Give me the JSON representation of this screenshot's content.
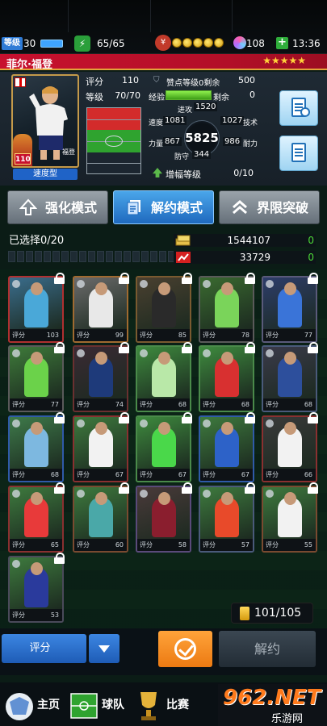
{
  "status": {
    "level_label": "等级",
    "level": "30",
    "energy": "65/65",
    "gems": "108",
    "time": "13:36"
  },
  "player": {
    "name": "菲尔·福登",
    "stars": "★★★★★",
    "card_rating": "110",
    "card_name": "福登",
    "type": "速度型",
    "rating_label": "评分",
    "rating": "110",
    "level_label": "等级",
    "level": "70/70",
    "likes_label": "赞点等级0剩余",
    "likes_remaining": "500",
    "exp_label": "经验",
    "exp_remaining_label": "剩余",
    "exp_remaining": "0",
    "exp_fill": 1.0,
    "attack_label": "进攻",
    "attack": "1520",
    "speed_label": "速度",
    "speed": "1081",
    "technique_value": "1027",
    "technique_label": "技术",
    "overall": "5825",
    "power_label": "力量",
    "power": "867",
    "stamina_value": "986",
    "stamina_label": "耐力",
    "defense_label": "防守",
    "defense": "344",
    "boost_label": "增幅等级",
    "boost": "0/10"
  },
  "tabs": [
    {
      "label": "强化模式"
    },
    {
      "label": "解约模式"
    },
    {
      "label": "界限突破"
    }
  ],
  "selection": {
    "label": "已选择0/20",
    "money": "1544107",
    "money_extra": "0",
    "points": "33729",
    "points_extra": "0"
  },
  "cards": [
    {
      "score_label": "评分",
      "score": "103",
      "bg": "#3a6d8c",
      "shirt": "#4aa8d8",
      "frame": "#b03030"
    },
    {
      "score_label": "评分",
      "score": "99",
      "bg": "#6b6b6b",
      "shirt": "#e8e8e8",
      "frame": "#a06a30"
    },
    {
      "score_label": "评分",
      "score": "85",
      "bg": "#4a4030",
      "shirt": "#2a2a2a",
      "frame": "#7a5a30"
    },
    {
      "score_label": "评分",
      "score": "78",
      "bg": "#3a6a30",
      "shirt": "#7ad45a",
      "frame": "#5a5a5a"
    },
    {
      "score_label": "评分",
      "score": "77",
      "bg": "#2d3d6a",
      "shirt": "#3a74d8",
      "frame": "#5a5a7a"
    },
    {
      "score_label": "评分",
      "score": "77",
      "bg": "#3e7a3a",
      "shirt": "#6bd24a",
      "frame": "#5a5a5a"
    },
    {
      "score_label": "评分",
      "score": "74",
      "bg": "#3a2a34",
      "shirt": "#1e3a7a",
      "frame": "#6a3030"
    },
    {
      "score_label": "评分",
      "score": "68",
      "bg": "#3e8a3e",
      "shirt": "#b9e8a8",
      "frame": "#4a8a4a"
    },
    {
      "score_label": "评分",
      "score": "68",
      "bg": "#3e8a3e",
      "shirt": "#d83030",
      "frame": "#4a8a4a"
    },
    {
      "score_label": "评分",
      "score": "68",
      "bg": "#3a3a4a",
      "shirt": "#2d4f9c",
      "frame": "#4a5a7a"
    },
    {
      "score_label": "评分",
      "score": "68",
      "bg": "#3e7a4a",
      "shirt": "#7db8e0",
      "frame": "#2f5aa8"
    },
    {
      "score_label": "评分",
      "score": "67",
      "bg": "#3e7a3e",
      "shirt": "#f2f2f2",
      "frame": "#8a3030"
    },
    {
      "score_label": "评分",
      "score": "67",
      "bg": "#3e8a3e",
      "shirt": "#4ad84a",
      "frame": "#4a8a4a"
    },
    {
      "score_label": "评分",
      "score": "67",
      "bg": "#3e7a3e",
      "shirt": "#2d62c8",
      "frame": "#2f5aa8"
    },
    {
      "score_label": "评分",
      "score": "66",
      "bg": "#3a3a3a",
      "shirt": "#f2f2f2",
      "frame": "#8a3030"
    },
    {
      "score_label": "评分",
      "score": "65",
      "bg": "#3e7a3e",
      "shirt": "#e83a3a",
      "frame": "#8a3030"
    },
    {
      "score_label": "评分",
      "score": "60",
      "bg": "#3e7a3e",
      "shirt": "#4aa8a8",
      "frame": "#7a4a30"
    },
    {
      "score_label": "评分",
      "score": "58",
      "bg": "#4a3a3a",
      "shirt": "#8a1e2e",
      "frame": "#5a4a7a"
    },
    {
      "score_label": "评分",
      "score": "57",
      "bg": "#3e7a3e",
      "shirt": "#e84a2a",
      "frame": "#4a5a7a"
    },
    {
      "score_label": "评分",
      "score": "55",
      "bg": "#3e7a3e",
      "shirt": "#f2f2f2",
      "frame": "#7a4a30"
    },
    {
      "score_label": "评分",
      "score": "53",
      "bg": "#3e7a3e",
      "shirt": "#2a3a9c",
      "frame": "#4a4a5a"
    }
  ],
  "capacity": "101/105",
  "controls": {
    "sort_label": "评分",
    "release_label": "解约"
  },
  "nav": [
    {
      "label": "主页"
    },
    {
      "label": "球队"
    },
    {
      "label": "比赛"
    }
  ],
  "watermark": {
    "number": "962.NET",
    "text": "乐游网"
  }
}
